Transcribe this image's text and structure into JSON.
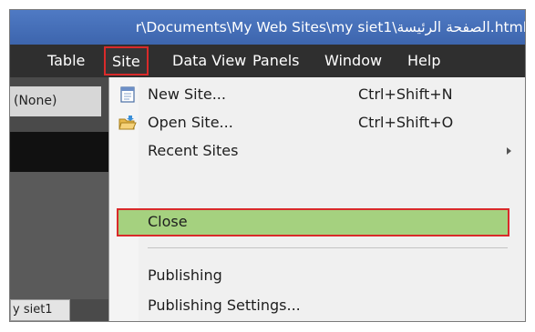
{
  "window": {
    "title_path": "r\\Documents\\My Web Sites\\my siet1\\الصفحة الرئيسة.html"
  },
  "menubar": {
    "items": [
      "Table",
      "Site",
      "Data View",
      "Panels",
      "Window",
      "Help"
    ]
  },
  "left_panel": {
    "dropdown_value": "(None)",
    "tab_label": "y siet1"
  },
  "site_menu": {
    "new_site": {
      "label": "New Site...",
      "shortcut": "Ctrl+Shift+N",
      "icon": "new-site-icon"
    },
    "open_site": {
      "label": "Open Site...",
      "shortcut": "Ctrl+Shift+O",
      "icon": "open-folder-icon"
    },
    "recent_sites": {
      "label": "Recent Sites"
    },
    "close": {
      "label": "Close"
    },
    "publishing": {
      "label": "Publishing"
    },
    "publishing_settings": {
      "label": "Publishing Settings..."
    }
  },
  "colors": {
    "highlight_fill": "#a5d17f",
    "highlight_border": "#d92a2a",
    "menubar_bg": "#2f2f2f",
    "titlebar_bg": "#4a74bf"
  }
}
